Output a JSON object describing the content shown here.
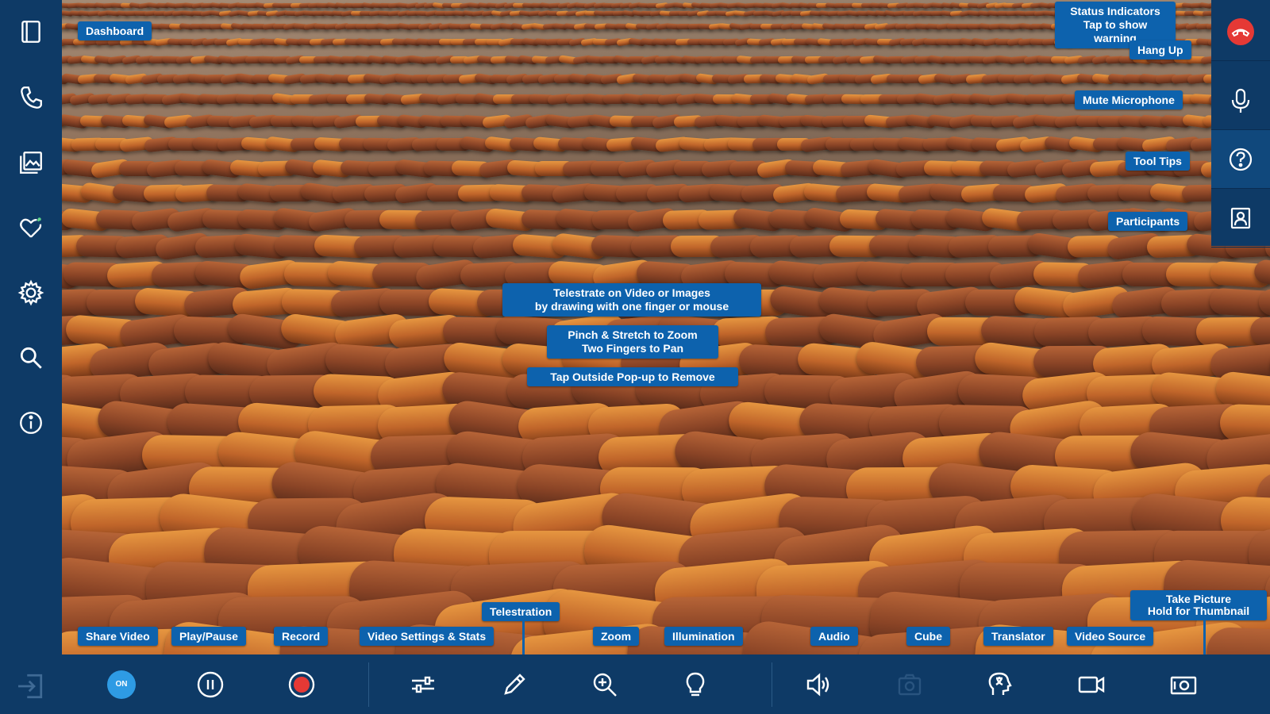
{
  "colors": {
    "panel": "#0e3a66",
    "tooltip": "#0d62ad",
    "hangup": "#e53935",
    "record": "#e53935",
    "on_badge": "#2e9be4"
  },
  "sidebar": {
    "items": [
      {
        "name": "dashboard-icon"
      },
      {
        "name": "phone-icon"
      },
      {
        "name": "gallery-icon"
      },
      {
        "name": "favorites-icon"
      },
      {
        "name": "settings-icon"
      },
      {
        "name": "search-icon"
      },
      {
        "name": "info-icon"
      }
    ],
    "exit_icon": "exit-icon"
  },
  "tooltips": {
    "dashboard": "Dashboard",
    "status_1": "Status Indicators",
    "status_2": "Tap to show warning",
    "hang_up": "Hang Up",
    "mute": "Mute Microphone",
    "tool_tips": "Tool Tips",
    "participants": "Participants",
    "telestrate_1": "Telestrate on Video or Images",
    "telestrate_2": "by drawing with one finger or mouse",
    "pinch_1": "Pinch & Stretch to Zoom",
    "pinch_2": "Two Fingers to Pan",
    "tap_outside": "Tap Outside Pop-up to Remove",
    "take_picture_1": "Take Picture",
    "take_picture_2": "Hold for Thumbnail",
    "telestration": "Telestration",
    "share_video": "Share Video",
    "play_pause": "Play/Pause",
    "record": "Record",
    "video_settings": "Video Settings & Stats",
    "zoom": "Zoom",
    "illumination": "Illumination",
    "audio": "Audio",
    "cube": "Cube",
    "translator": "Translator",
    "video_source": "Video Source"
  },
  "bottombar": {
    "on_label": "ON"
  }
}
